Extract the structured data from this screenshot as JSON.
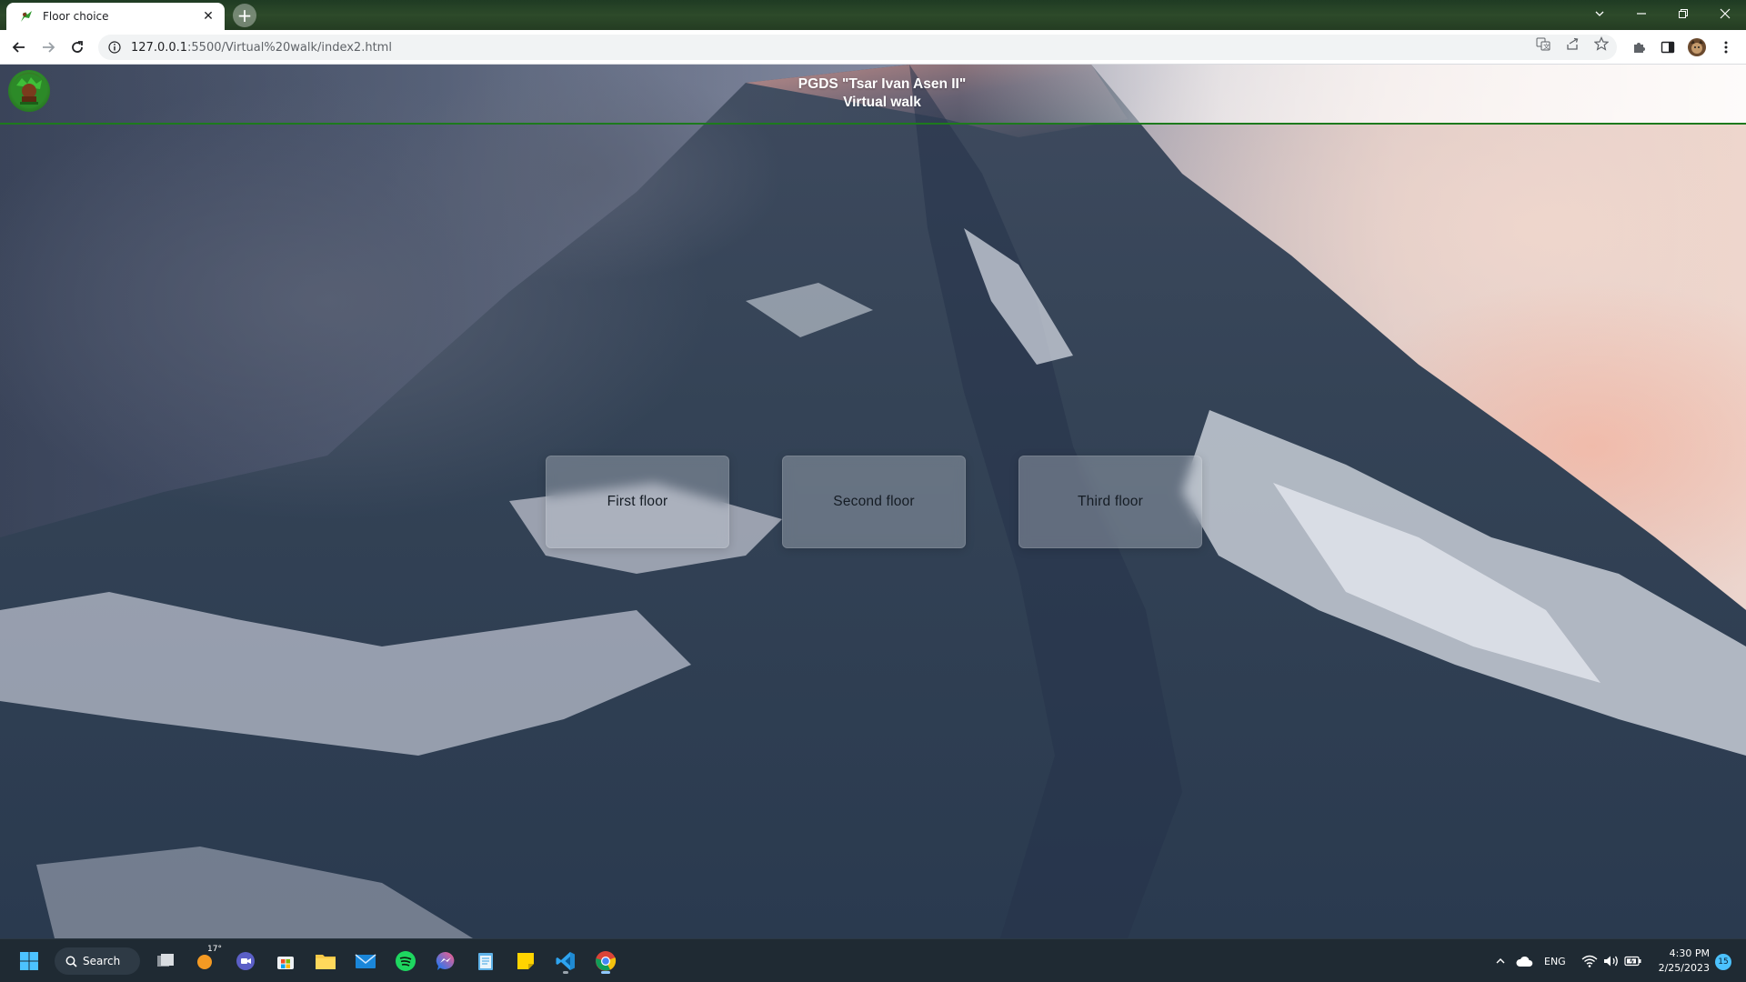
{
  "browser": {
    "tab_title": "Floor choice",
    "tab_close": "✕",
    "new_tab": "+",
    "url_host": "127.0.0.1",
    "url_rest": ":5500/Virtual%20walk/index2.html"
  },
  "page": {
    "header_line1": "PGDS \"Tsar Ivan Asen II\"",
    "header_line2": "Virtual walk",
    "floors": [
      {
        "label": "First floor"
      },
      {
        "label": "Second floor"
      },
      {
        "label": "Third floor"
      }
    ]
  },
  "taskbar": {
    "search_label": "Search",
    "weather_badge": "17°",
    "language": "ENG",
    "time": "4:30 PM",
    "date": "2/25/2023",
    "notification_count": "15"
  },
  "colors": {
    "header_border": "#1d7a1d",
    "taskbar_bg": "#1f2a33",
    "accent": "#0078d4"
  }
}
